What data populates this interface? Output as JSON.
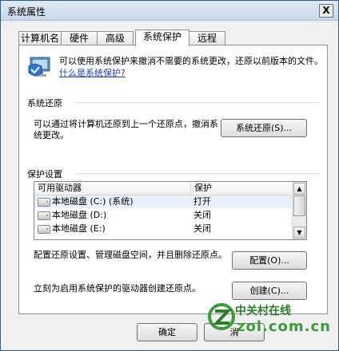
{
  "window": {
    "title": "系统属性",
    "close_label": "X"
  },
  "tabs": [
    {
      "label": "计算机名"
    },
    {
      "label": "硬件"
    },
    {
      "label": "高级"
    },
    {
      "label": "系统保护"
    },
    {
      "label": "远程"
    }
  ],
  "intro": {
    "text": "可以使用系统保护来撤消不需要的系统更改，还原以前版本的文件。",
    "link": "什么是系统保护?"
  },
  "restore": {
    "heading": "系统还原",
    "description": "可以通过将计算机还原到上一个还原点，撤消系统更改。",
    "button": "系统还原(S)..."
  },
  "protection": {
    "heading": "保护设置",
    "columns": [
      "可用驱动器",
      "保护"
    ],
    "drives": [
      {
        "name": "本地磁盘 (C:) (系统)",
        "protection": "打开"
      },
      {
        "name": "本地磁盘 (D:)",
        "protection": "关闭"
      },
      {
        "name": "本地磁盘 (E:)",
        "protection": "关闭"
      }
    ],
    "configure_text": "配置还原设置、管理磁盘空间，并且删除还原点。",
    "configure_button": "配置(O)...",
    "create_text": "立刻为启用系统保护的驱动器创建还原点。",
    "create_button": "创建(C)..."
  },
  "footer": {
    "ok": "确定",
    "cancel": "消"
  },
  "watermark": {
    "line1": "中关村在线",
    "line2": "zol.com.cn",
    "color": "#3b9b3b"
  }
}
